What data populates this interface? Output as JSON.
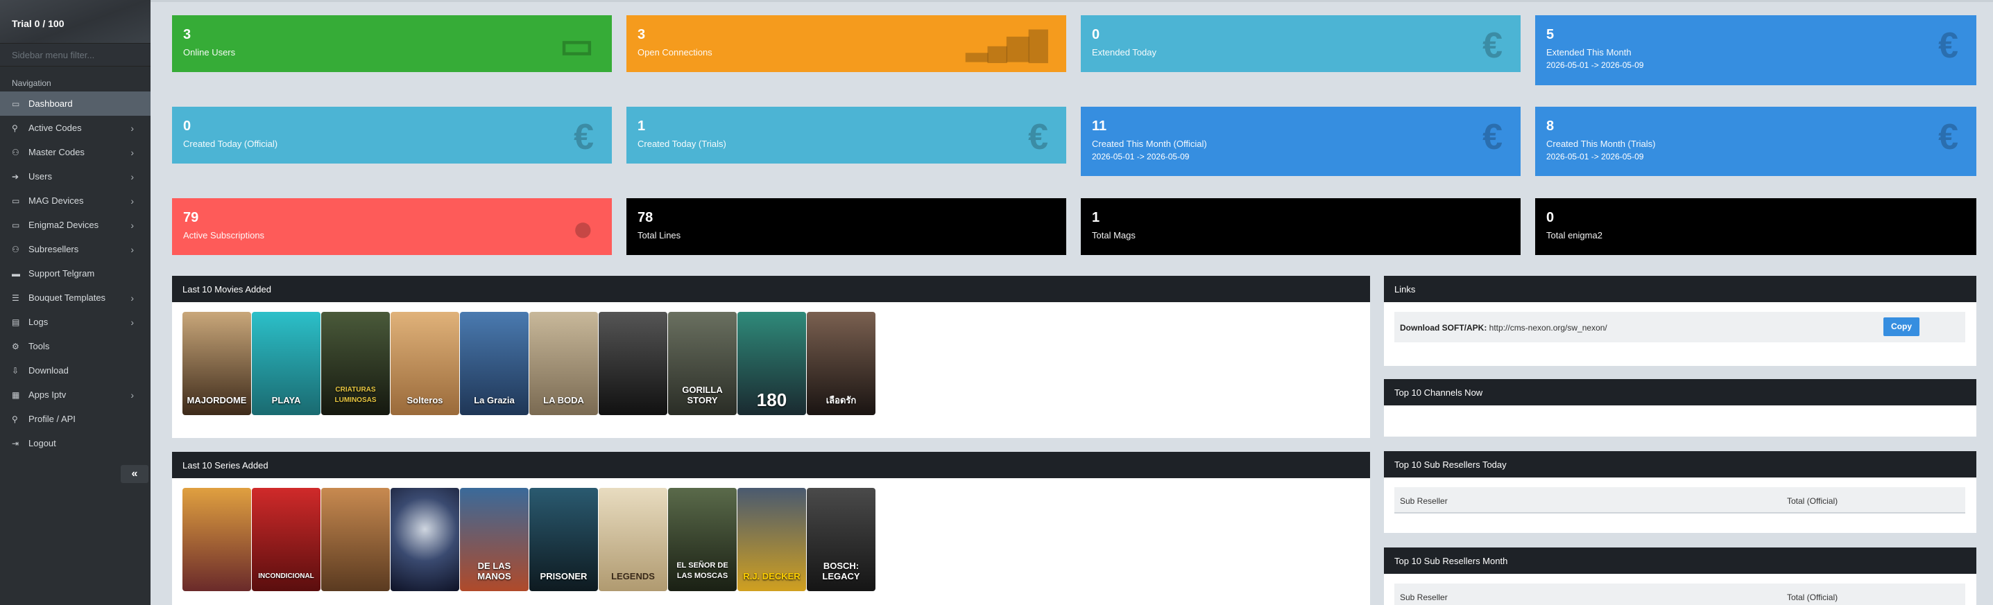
{
  "sidebar": {
    "trial": "Trial 0 / 100",
    "filter_placeholder": "Sidebar menu filter...",
    "nav_label": "Navigation",
    "items": [
      {
        "label": "Dashboard",
        "icon": "monitor-icon"
      },
      {
        "label": "Active Codes",
        "icon": "user-icon"
      },
      {
        "label": "Master Codes",
        "icon": "users-icon"
      },
      {
        "label": "Users",
        "icon": "sign-in-icon"
      },
      {
        "label": "MAG Devices",
        "icon": "desktop-icon"
      },
      {
        "label": "Enigma2 Devices",
        "icon": "desktop-icon"
      },
      {
        "label": "Subresellers",
        "icon": "users-icon"
      },
      {
        "label": "Support Telgram",
        "icon": "support-icon"
      },
      {
        "label": "Bouquet Templates",
        "icon": "list-icon"
      },
      {
        "label": "Logs",
        "icon": "file-icon"
      },
      {
        "label": "Tools",
        "icon": "gear-icon"
      },
      {
        "label": "Download",
        "icon": "download-icon"
      },
      {
        "label": "Apps Iptv",
        "icon": "apps-icon"
      },
      {
        "label": "Profile / API",
        "icon": "user-icon"
      },
      {
        "label": "Logout",
        "icon": "logout-icon"
      }
    ],
    "collapse_label": "«"
  },
  "stats": [
    {
      "value": "3",
      "label": "Online Users",
      "sub": "",
      "icon": "monitor-icon",
      "color": "#36ac37"
    },
    {
      "value": "3",
      "label": "Open Connections",
      "sub": "",
      "icon": "signal-icon",
      "color": "#f59b1d"
    },
    {
      "value": "0",
      "label": "Extended Today",
      "sub": "",
      "icon": "euro-icon",
      "color": "#4cb4d4"
    },
    {
      "value": "5",
      "label": "Extended This Month",
      "sub": "2026-05-01 -> 2026-05-09",
      "icon": "euro-icon",
      "color": "#368ee0"
    },
    {
      "value": "0",
      "label": "Created Today (Official)",
      "sub": "",
      "icon": "euro-icon",
      "color": "#4cb4d4"
    },
    {
      "value": "1",
      "label": "Created Today (Trials)",
      "sub": "",
      "icon": "euro-icon",
      "color": "#4cb4d4"
    },
    {
      "value": "11",
      "label": "Created This Month (Official)",
      "sub": "2026-05-01 -> 2026-05-09",
      "icon": "euro-icon",
      "color": "#368ee0"
    },
    {
      "value": "8",
      "label": "Created This Month (Trials)",
      "sub": "2026-05-01 -> 2026-05-09",
      "icon": "euro-icon",
      "color": "#368ee0"
    },
    {
      "value": "79",
      "label": "Active Subscriptions",
      "sub": "",
      "icon": "user-icon",
      "color": "#fe5b59"
    },
    {
      "value": "78",
      "label": "Total Lines",
      "sub": "",
      "icon": "",
      "color": "#000000"
    },
    {
      "value": "1",
      "label": "Total Mags",
      "sub": "",
      "icon": "",
      "color": "#000000"
    },
    {
      "value": "0",
      "label": "Total enigma2",
      "sub": "",
      "icon": "",
      "color": "#000000"
    }
  ],
  "movies": {
    "title": "Last 10 Movies Added",
    "posters": [
      "MAJORDOME",
      "PLAYA",
      "CRIATURAS LUMINOSAS",
      "Solteros",
      "La Grazia",
      "LA BODA",
      "",
      "GORILLA STORY",
      "180",
      "เลือดรัก"
    ]
  },
  "series": {
    "title": "Last 10 Series Added",
    "posters": [
      "",
      "INCONDICIONAL",
      "",
      "",
      "DE LAS MANOS",
      "PRISONER",
      "LEGENDS",
      "EL SEÑOR DE LAS MOSCAS",
      "R.J. DECKER",
      "BOSCH: LEGACY"
    ]
  },
  "links": {
    "title": "Links",
    "label": "Download SOFT/APK:",
    "url": "http://cms-nexon.org/sw_nexon/",
    "copy": "Copy"
  },
  "top_channels": {
    "title": "Top 10 Channels Now"
  },
  "top_sub_today": {
    "title": "Top 10 Sub Resellers Today",
    "col1": "Sub Reseller",
    "col2": "Total (Official)"
  },
  "top_sub_month": {
    "title": "Top 10 Sub Resellers Month",
    "col1": "Sub Reseller",
    "col2": "Total (Official)"
  }
}
